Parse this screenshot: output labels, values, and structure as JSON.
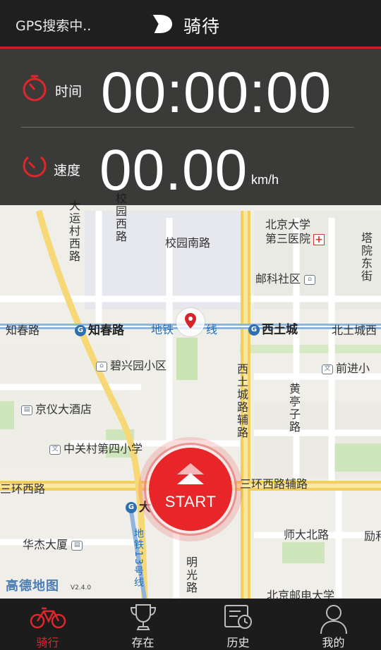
{
  "header": {
    "gps_status": "GPS搜索中..",
    "app_title": "骑待",
    "logo_icon": "brand-d-logo-icon"
  },
  "stats": {
    "time": {
      "label": "时间",
      "value": "00:00:00",
      "icon": "stopwatch-icon"
    },
    "speed": {
      "label": "速度",
      "value": "00.00",
      "unit": "km/h",
      "icon": "speedometer-icon"
    }
  },
  "map": {
    "labels": {
      "xiyuan_rd": "校园西路",
      "yuncun_rd": "大运村西路",
      "xiaoyuan_nanlu": "校园南路",
      "pku_hospital_1": "北京大学",
      "pku_hospital_2": "第三医院",
      "post_office": "邮科社区",
      "tayuan": "塔院东街",
      "zhichun_rd": "知春路",
      "zhichunlu_station": "知春路",
      "metro_line": "地铁",
      "metro_line2": "线",
      "xitucheng_station": "西土城",
      "beituchengxi": "北土城西",
      "bixingyuan": "碧兴园小区",
      "qianjin": "前进小",
      "xitucheng_rd": "西土城路辅路",
      "huangting": "黄亭子路",
      "jingyi_hotel": "京仪大酒店",
      "zhongguancun_4": "中关村第四小学",
      "third_ring_w": "三环西路",
      "third_ring_aux": "三环西路辅路",
      "da_station": "大",
      "huajie": "华杰大厦",
      "shida_bei": "师大北路",
      "lizhi": "励和",
      "line13": "地铁13号线",
      "mingguang": "明光路",
      "bupt": "北京邮电大学",
      "amap_logo": "高德地图",
      "amap_version": "V2.4.0"
    }
  },
  "start_button": {
    "label": "START",
    "icon": "double-chevron-up-icon"
  },
  "nav": {
    "items": [
      {
        "label": "骑行",
        "icon": "bicycle-icon",
        "active": true
      },
      {
        "label": "存在",
        "icon": "trophy-icon",
        "active": false
      },
      {
        "label": "历史",
        "icon": "history-icon",
        "active": false
      },
      {
        "label": "我的",
        "icon": "user-icon",
        "active": false
      }
    ]
  },
  "colors": {
    "accent": "#e8262a",
    "topbar": "#1f1f1f",
    "map_bg": "#efeee8",
    "road_major": "#f7d56e",
    "metro": "#2d6fb0"
  }
}
